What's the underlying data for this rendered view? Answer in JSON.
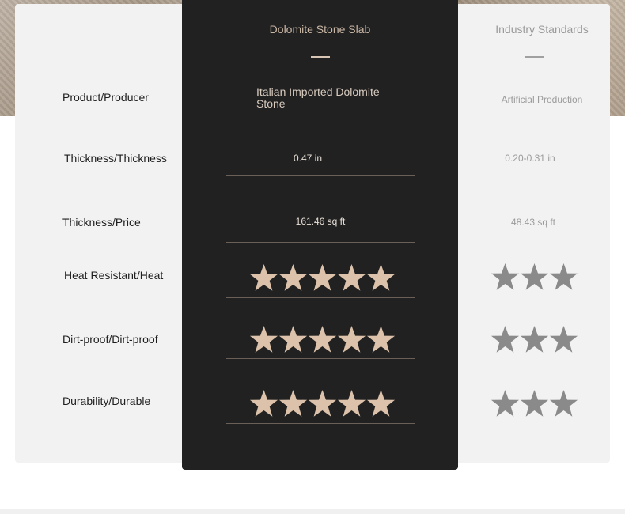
{
  "columns": {
    "product": "Dolomite Stone Slab",
    "standard": "Industry Standards"
  },
  "rows": [
    {
      "label": "Product/Producer",
      "product_value": "Italian Imported Dolomite Stone",
      "standard_value": "Artificial Production"
    },
    {
      "label": "Thickness/Thickness",
      "product_value": "0.47 in",
      "standard_value": "0.20-0.31 in"
    },
    {
      "label": "Thickness/Price",
      "product_value": "161.46 sq ft",
      "standard_value": "48.43 sq ft"
    },
    {
      "label": "Heat Resistant/Heat",
      "product_rating": 5,
      "standard_rating": 3
    },
    {
      "label": "Dirt-proof/Dirt-proof",
      "product_rating": 5,
      "standard_rating": 3
    },
    {
      "label": "Durability/Durable",
      "product_rating": 5,
      "standard_rating": 3
    }
  ],
  "colors": {
    "product_star": "#dcc2aa",
    "standard_star": "#8a8a8a",
    "panel": "#222121"
  }
}
